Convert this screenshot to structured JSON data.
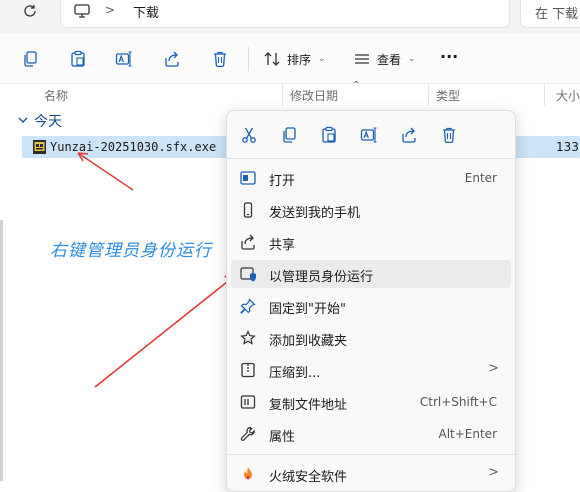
{
  "address": {
    "breadcrumb_sep": ">",
    "current_folder": "下载",
    "search_placeholder": "在 下载"
  },
  "toolbar": {
    "sort_label": "排序",
    "view_label": "查看",
    "more_label": "···"
  },
  "columns": {
    "name": "名称",
    "modified": "修改日期",
    "type": "类型",
    "size": "大小"
  },
  "group": {
    "label": "今天"
  },
  "file": {
    "name": "Yunzai-20251030.sfx.exe",
    "size": "133,"
  },
  "annotation": "右键管理员身份运行",
  "context_menu": {
    "quick_actions": [
      "cut-icon",
      "copy-icon",
      "paste-icon",
      "rename-icon",
      "share-icon",
      "delete-icon"
    ],
    "items": [
      {
        "label": "打开",
        "shortcut": "Enter"
      },
      {
        "label": "发送到我的手机",
        "shortcut": ""
      },
      {
        "label": "共享",
        "shortcut": ""
      },
      {
        "label": "以管理员身份运行",
        "shortcut": ""
      },
      {
        "label": "固定到\"开始\"",
        "shortcut": ""
      },
      {
        "label": "添加到收藏夹",
        "shortcut": ""
      },
      {
        "label": "压缩到...",
        "shortcut": ""
      },
      {
        "label": "复制文件地址",
        "shortcut": "Ctrl+Shift+C"
      },
      {
        "label": "属性",
        "shortcut": "Alt+Enter"
      },
      {
        "label": "火绒安全软件",
        "shortcut": ""
      }
    ],
    "submenu_arrow": ">"
  }
}
